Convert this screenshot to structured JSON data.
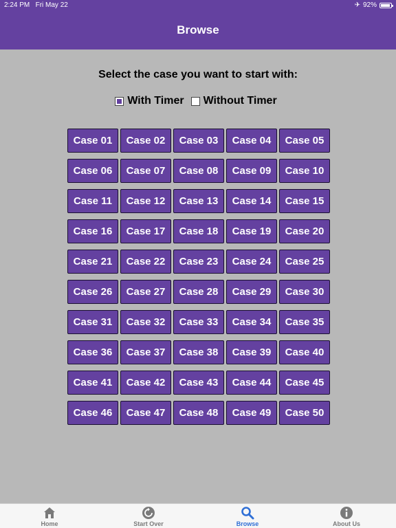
{
  "status": {
    "time": "2:24 PM",
    "date": "Fri May 22",
    "battery": "92%",
    "battery_level": 0.92
  },
  "nav": {
    "title": "Browse"
  },
  "prompt": "Select the case you want to start with:",
  "timer": {
    "with_label": "With Timer",
    "without_label": "Without Timer",
    "selected": "with"
  },
  "cases": [
    "Case 01",
    "Case 02",
    "Case 03",
    "Case 04",
    "Case 05",
    "Case 06",
    "Case 07",
    "Case 08",
    "Case 09",
    "Case 10",
    "Case 11",
    "Case 12",
    "Case 13",
    "Case 14",
    "Case 15",
    "Case 16",
    "Case 17",
    "Case 18",
    "Case 19",
    "Case 20",
    "Case 21",
    "Case 22",
    "Case 23",
    "Case 24",
    "Case 25",
    "Case 26",
    "Case 27",
    "Case 28",
    "Case 29",
    "Case 30",
    "Case 31",
    "Case 32",
    "Case 33",
    "Case 34",
    "Case 35",
    "Case 36",
    "Case 37",
    "Case 38",
    "Case 39",
    "Case 40",
    "Case 41",
    "Case 42",
    "Case 43",
    "Case 44",
    "Case 45",
    "Case 46",
    "Case 47",
    "Case 48",
    "Case 49",
    "Case 50"
  ],
  "tabs": [
    {
      "label": "Home",
      "icon": "home-icon"
    },
    {
      "label": "Start Over",
      "icon": "restart-icon"
    },
    {
      "label": "Browse",
      "icon": "search-icon"
    },
    {
      "label": "About Us",
      "icon": "info-icon"
    }
  ],
  "active_tab": 2,
  "colors": {
    "accent": "#6441a0",
    "background": "#b8b8b8",
    "tab_active": "#2f6fd6",
    "tab_inactive": "#7a7a7a"
  }
}
